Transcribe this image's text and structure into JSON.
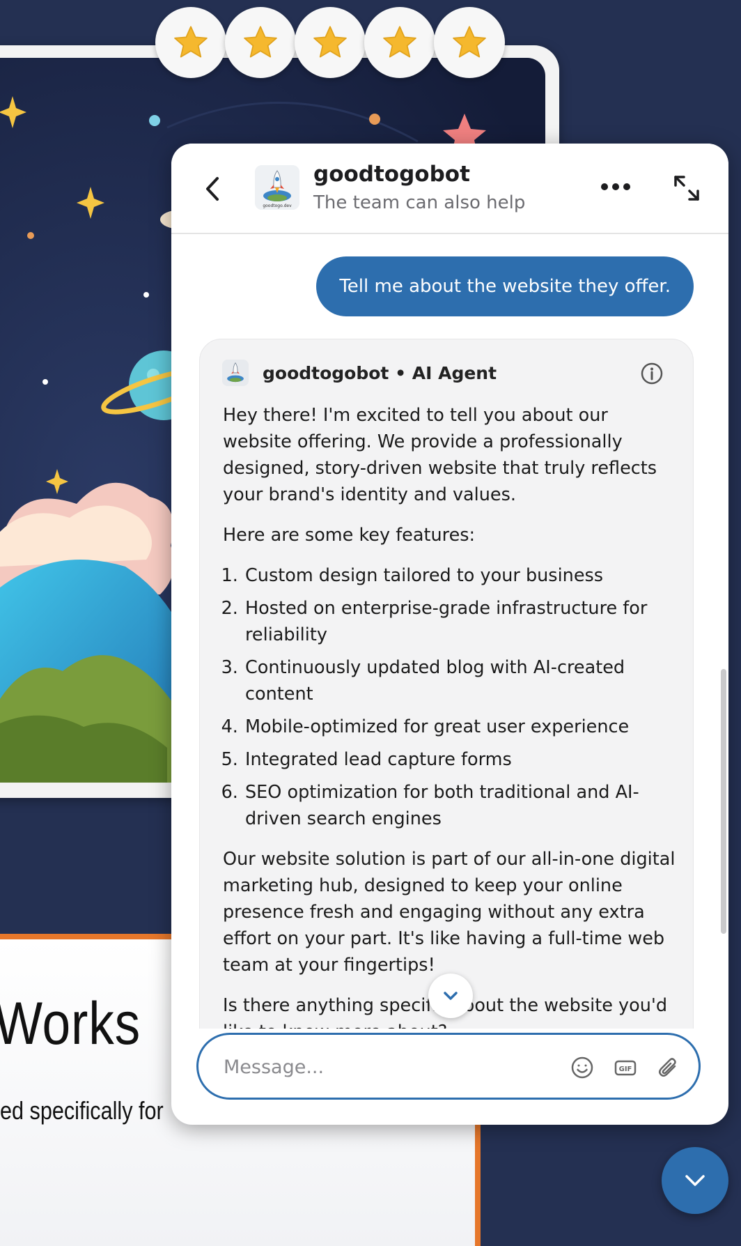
{
  "rating": {
    "stars": 5,
    "max": 5
  },
  "page": {
    "heading": "Works",
    "subtext": "ed specifically for"
  },
  "chat": {
    "header": {
      "bot_name": "goodtogobot",
      "subtitle": "The team can also help",
      "avatar_caption": "goodtogo.dev"
    },
    "user_message": "Tell me about the website they offer.",
    "bot_message": {
      "sender": "goodtogobot • AI Agent",
      "intro": "Hey there! I'm excited to tell you about our website offering. We provide a professionally designed, story-driven website that truly reflects your brand's identity and values.",
      "features_heading": "Here are some key features:",
      "features": [
        "Custom design tailored to your business",
        "Hosted on enterprise-grade infrastructure for reliability",
        "Continuously updated blog with AI-created content",
        "Mobile-optimized for great user experience",
        "Integrated lead capture forms",
        "SEO optimization for both traditional and AI-driven search engines"
      ],
      "closing": "Our website solution is part of our all-in-one digital marketing hub, designed to keep your online presence fresh and engaging without any extra effort on your part. It's like having a full-time web team at your fingertips!",
      "question": "Is there anything specific about the website you'd like to know more about?"
    },
    "composer": {
      "placeholder": "Message...",
      "gif_label": "GIF"
    }
  },
  "colors": {
    "accent": "#2d6eae",
    "page_bg": "#243052",
    "orange": "#e6772b",
    "star": "#f5b82e"
  },
  "icons": [
    "star-icon",
    "chevron-left-icon",
    "more-icon",
    "expand-icon",
    "info-icon",
    "chevron-down-icon",
    "emoji-icon",
    "gif-icon",
    "paperclip-icon"
  ]
}
